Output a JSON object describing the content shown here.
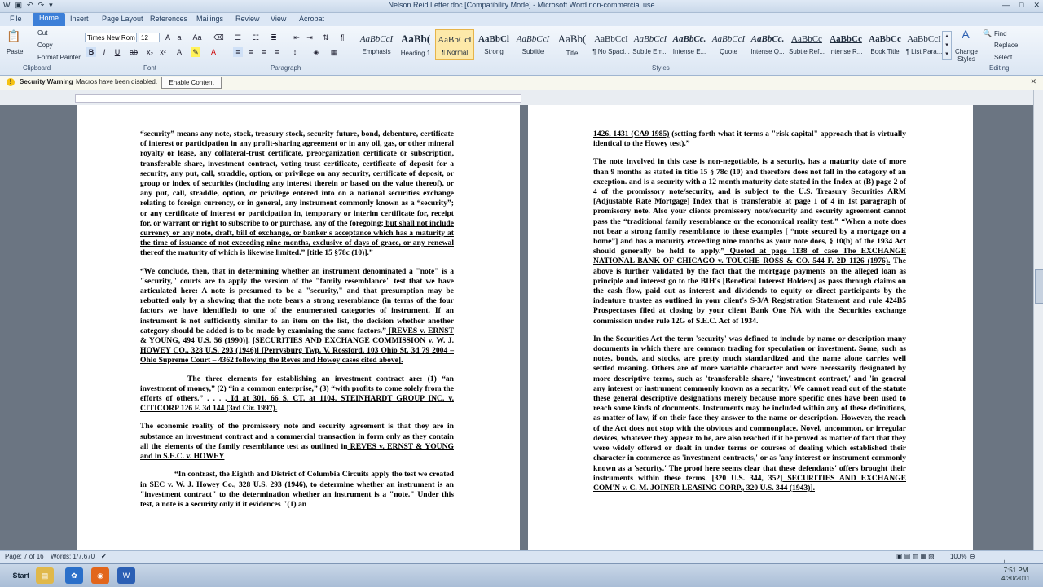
{
  "window": {
    "title": "Nelson Reid Letter.doc [Compatibility Mode] - Microsoft Word non-commercial use"
  },
  "tabs": [
    "File",
    "Home",
    "Insert",
    "Page Layout",
    "References",
    "Mailings",
    "Review",
    "View",
    "Acrobat"
  ],
  "ribbon": {
    "clipboard": {
      "paste": "Paste",
      "cut": "Cut",
      "copy": "Copy",
      "format_painter": "Format Painter",
      "label": "Clipboard"
    },
    "font": {
      "name": "Times New Rom",
      "size": "12",
      "label": "Font"
    },
    "paragraph": {
      "label": "Paragraph"
    },
    "styles": {
      "label": "Styles",
      "items": [
        {
          "sample": "AaBbCcI",
          "name": "Emphasis"
        },
        {
          "sample": "AaBb(",
          "name": "Heading 1"
        },
        {
          "sample": "AaBbCcI",
          "name": "¶ Normal"
        },
        {
          "sample": "AaBbCl",
          "name": "Strong"
        },
        {
          "sample": "AaBbCcI",
          "name": "Subtitle"
        },
        {
          "sample": "AaBb(",
          "name": "Title"
        },
        {
          "sample": "AaBbCcI",
          "name": "¶ No Spaci..."
        },
        {
          "sample": "AaBbCcI",
          "name": "Subtle Em..."
        },
        {
          "sample": "AaBbCc.",
          "name": "Intense E..."
        },
        {
          "sample": "AaBbCcI",
          "name": "Quote"
        },
        {
          "sample": "AaBbCc.",
          "name": "Intense Q..."
        },
        {
          "sample": "AaBbCc",
          "name": "Subtle Ref..."
        },
        {
          "sample": "AaBbCc",
          "name": "Intense R..."
        },
        {
          "sample": "AaBbCc",
          "name": "Book Title"
        },
        {
          "sample": "AaBbCcI",
          "name": "¶ List Para..."
        }
      ],
      "change_styles": "Change Styles"
    },
    "editing": {
      "find": "Find",
      "replace": "Replace",
      "select": "Select",
      "label": "Editing"
    }
  },
  "message_bar": {
    "title": "Security Warning",
    "text": "Macros have been disabled.",
    "button": "Enable Content"
  },
  "left_page": {
    "p1": "“security” means any note, stock, treasury stock, security future, bond, debenture, certificate of interest or participation in any profit-sharing agreement or in any oil, gas, or other mineral royalty or lease, any collateral-trust certificate, preorganization certificate or subscription, transferable share, investment contract, voting-trust certificate, certificate of deposit for a security, any put, call, straddle, option, or privilege on any security, certificate of deposit, or group or index of securities (including any interest therein or based on the value thereof), or any put, call, straddle, option, or privilege entered into on a national securities exchange relating to foreign currency, or in general, any instrument commonly known as a “security”; or any certificate of interest or participation in, temporary or interim certificate for, receipt for, or warrant or right to subscribe to or purchase, any of the foregoing;",
    "p1_u": " but shall not include currency or any note, draft, bill of exchange, or banker's acceptance which has a maturity at the time of issuance of not exceeding nine months, exclusive of days of grace, or any renewal thereof the maturity of which is likewise limited.” [title 15 §78c (10)].”",
    "p2": "“We conclude, then, that in determining whether an instrument denominated a \"note\" is a \"security,\" courts are to apply the version of the \"family resemblance\" test that we have articulated here: A note is presumed to be a \"security,\" and that presumption may be rebutted only by a showing that the note bears a strong resemblance (in terms of the four factors we have identified) to one of the enumerated categories of instrument. If an instrument is not sufficiently similar to an item on the list, the decision whether another category should be added is to be made by examining the same factors.”",
    "p2_u": " [REVES v. ERNST & YOUNG, 494 U.S. 56 (1990)]. [SECURITIES AND EXCHANGE COMMISSION v. W. J. HOWEY CO., 328 U.S. 293 (1946)] [Perrysburg Twp. V. Rossford, 103 Ohio St. 3d 79 2004 – Ohio Supreme Court – 4362 following the Reves and Howey cases cited above].",
    "p3": "The three elements for establishing an investment contract are: (1) “an investment of money,” (2) “in a common enterprise,” (3) “with profits to come solely from the efforts of others.” . . . .",
    "p3_u": " Id at 301, 66 S. CT. at 1104. STEINHARDT GROUP INC. v. CITICORP 126 F. 3d 144 (3rd Cir. 1997).",
    "p4": "The economic reality of the promissory note and security agreement is that they are in substance an investment contract and a commercial transaction in form only as they contain all the elements of the family resemblance test as outlined in",
    "p4_u": " REVES v. ERNST & YOUNG and in S.E.C. v. HOWEY",
    "p5": "“In contrast, the Eighth and District of Columbia Circuits apply the test we created in SEC v. W. J. Howey Co., 328 U.S. 293 (1946), to determine whether an instrument is an \"investment contract\" to the determination whether an instrument is a \"note.\" Under this test, a note is a security only if it evidences \"(1) an"
  },
  "right_page": {
    "p1_u": "1426, 1431 (CA9 1985)",
    "p1": " (setting forth what it terms a \"risk capital\" approach that is virtually identical to the Howey test).”",
    "p2": "The note involved in this case is non-negotiable, is a security, has a maturity date of more than 9 months as stated in title 15 § 78c (10) and therefore does not fall in the category of an exception. and is a security with a 12 month maturity date stated in the Index at (B) page 2 of 4 of the promissory note/security, and is subject to the U.S. Treasury Securities ARM [Adjustable Rate Mortgage] Index that is transferable at page 1 of 4 in 1st paragraph of promissory note. Also your clients promissory note/security and security agreement cannot pass the “traditional family resemblance or the economical reality test.” “When a note does not bear a strong family resemblance to these examples [ “note secured by a mortgage on a home”] and has a maturity exceeding nine months as your note does, § 10(b) of the 1934 Act should generally be held to apply.”",
    "p2_u": " Quoted at page 1138 of case The EXCHANGE NATIONAL BANK OF CHICAGO v. TOUCHE ROSS & CO. 544 F. 2D 1126 (1976).",
    "p2b": " The above is further validated by the fact that the mortgage payments on the alleged loan as principle and interest go to the BIH's [Benefical Interest Holders] as pass through claims on the cash flow, paid out as interest and dividends to equity or direct participants by the indenture trustee as outlined in your client's S-3/A Registration Statement and rule 424B5 Prospectuses filed at closing by your client Bank One NA with the Securities exchange commission under rule 12G of S.E.C. Act of 1934.",
    "p3": "In the Securities Act the term 'security' was defined to include by name or description many documents in which there are common trading for speculation or investment. Some, such as notes, bonds, and stocks, are pretty much standardized and the name alone carries well settled meaning. Others are of more variable character and were necessarily designated by more descriptive terms, such as 'transferable share,' 'investment contract,' and 'in general any interest or instrument commonly known as a security.' We cannot read out of the statute these general descriptive designations merely because more specific ones have been used to reach some kinds of documents. Instruments may be included within any of these definitions, as matter of law, if on their face they answer to the name or description. However, the reach of the Act does not stop with the obvious and commonplace. Novel, uncommon, or irregular devices, whatever they appear to be, are also reached if it be proved as matter of fact that they were widely offered or dealt in under terms or courses of dealing which established their character in commerce as 'investment contracts,' or as 'any interest or instrument commonly known as a 'security.' The proof here seems clear that these defendants' offers brought their instruments within these terms. [320 U.S. 344, 352]",
    "p3_u": " SECURITIES AND EXCHANGE COM'N v. C. M. JOINER LEASING CORP., 320 U.S. 344 (1943)]."
  },
  "status": {
    "page": "Page: 7 of 16",
    "words": "Words: 1/7,670",
    "zoom": "100%"
  },
  "taskbar": {
    "start": "Start",
    "time": "7:51 PM",
    "date": "4/30/2011"
  }
}
